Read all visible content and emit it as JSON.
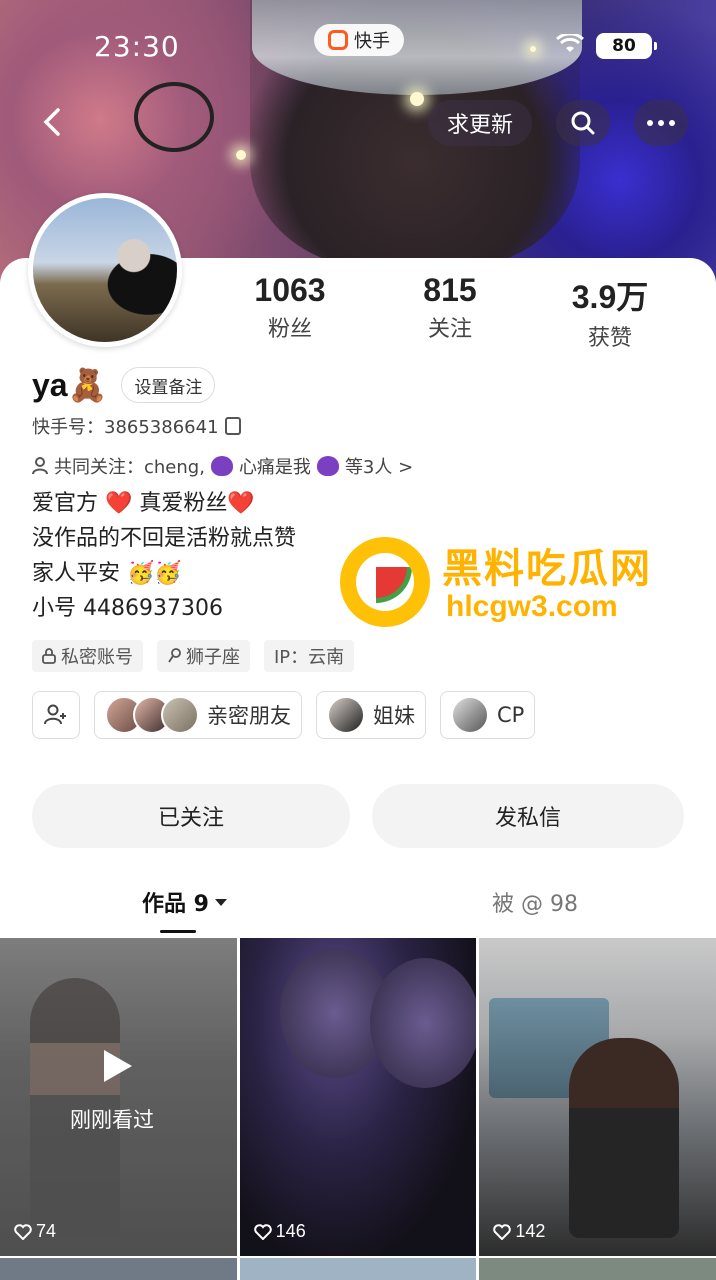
{
  "status_bar": {
    "time": "23:30",
    "app_name": "快手",
    "battery": "80"
  },
  "nav": {
    "refresh_label": "求更新"
  },
  "stats": [
    {
      "value": "1063",
      "label": "粉丝"
    },
    {
      "value": "815",
      "label": "关注"
    },
    {
      "value": "3.9万",
      "label": "获赞"
    }
  ],
  "profile": {
    "name": "ya🧸",
    "remark_button": "设置备注",
    "kwai_id": "快手号：3865386641",
    "common_follow_prefix": "共同关注：cheng,",
    "common_follow_name": "心痛是我",
    "common_follow_suffix": "等3人 >"
  },
  "bio": {
    "line1": "爱官方 ❤️ 真爱粉丝❤️",
    "line2": "没作品的不回是活粉就点赞",
    "line3": "家人平安 🥳🥳",
    "line4": "小号 4486937306"
  },
  "tags": {
    "private": "私密账号",
    "zodiac": "狮子座",
    "ip": "IP：云南"
  },
  "friend_groups": {
    "close_friends": "亲密朋友",
    "sisters": "姐妹",
    "cp": "CP"
  },
  "actions": {
    "followed": "已关注",
    "message": "发私信"
  },
  "tabs": {
    "works": "作品 9",
    "mentioned": "被 @ 98"
  },
  "works": [
    {
      "likes": "74",
      "overlay": "刚刚看过"
    },
    {
      "likes": "146"
    },
    {
      "likes": "142"
    }
  ],
  "watermark": {
    "title": "黑料吃瓜网",
    "url": "hlcgw3.com"
  },
  "colors": {
    "accent_orange": "#ff5a1f",
    "watermark_yellow": "#ffb300"
  }
}
